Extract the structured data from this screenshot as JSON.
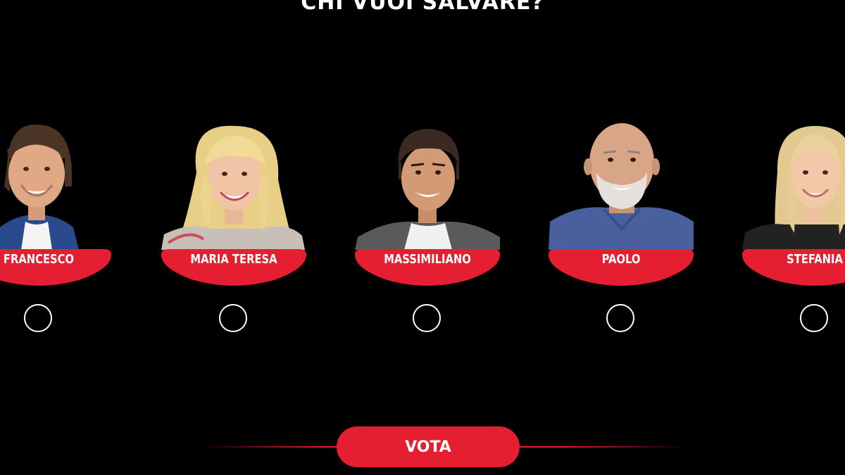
{
  "title": "CHI VUOI SALVARE?",
  "accent_color": "#e61e32",
  "candidates": [
    {
      "name": "FRANCESCO",
      "selected": false
    },
    {
      "name": "MARIA TERESA",
      "selected": false
    },
    {
      "name": "MASSIMILIANO",
      "selected": false
    },
    {
      "name": "PAOLO",
      "selected": false
    },
    {
      "name": "STEFANIA",
      "selected": false
    }
  ],
  "vote_button": {
    "label": "VOTA"
  }
}
